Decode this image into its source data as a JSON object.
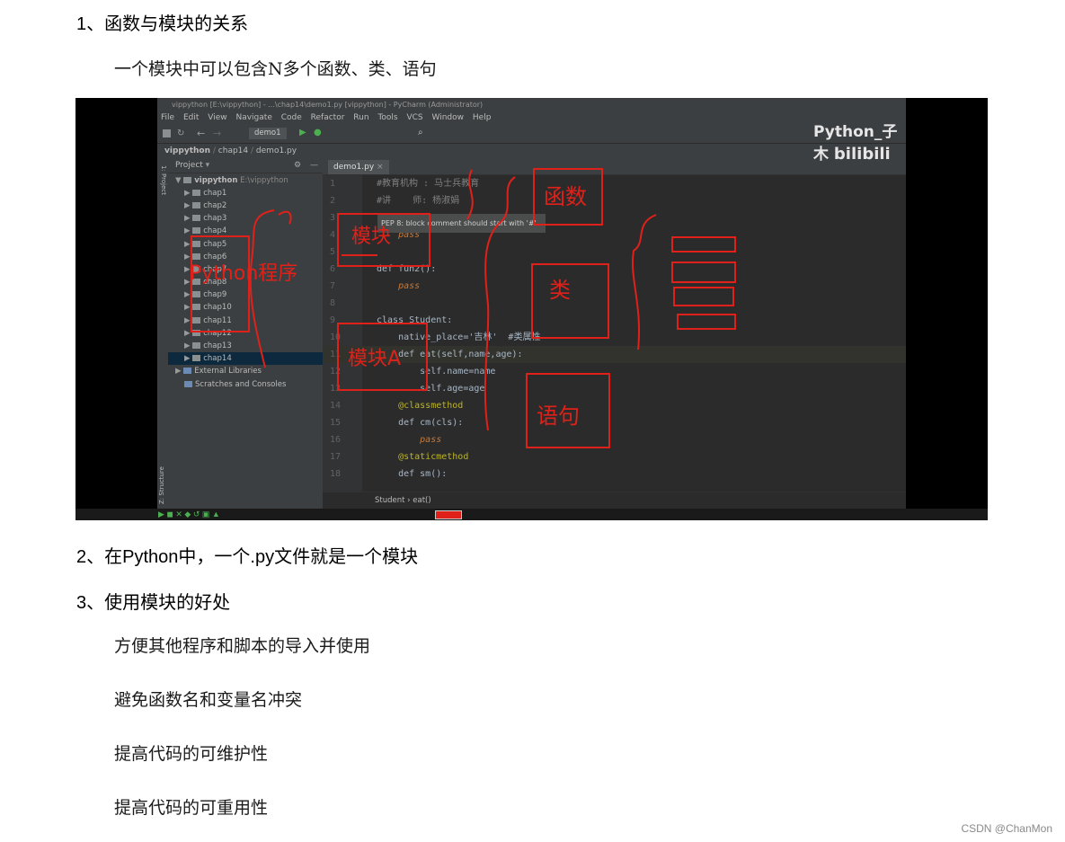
{
  "headings": {
    "h1": "1、函数与模块的关系",
    "h2": "2、在Python中，一个.py文件就是一个模块",
    "h3": "3、使用模块的好处"
  },
  "paragraphs": {
    "p1": "一个模块中可以包含N多个函数、类、语句",
    "b1": "方便其他程序和脚本的导入并使用",
    "b2": "避免函数名和变量名冲突",
    "b3": "提高代码的可维护性",
    "b4": "提高代码的可重用性"
  },
  "ide": {
    "title": "vippython [E:\\vippython] - ...\\chap14\\demo1.py [vippython] - PyCharm (Administrator)",
    "menu": [
      "File",
      "Edit",
      "View",
      "Navigate",
      "Code",
      "Refactor",
      "Run",
      "Tools",
      "VCS",
      "Window",
      "Help"
    ],
    "run_config": "demo1",
    "breadcrumb": [
      "vippython",
      "chap14",
      "demo1.py"
    ],
    "project_label": "Project",
    "project_root": "vippython",
    "project_root_path": "E:\\vippython",
    "folders": [
      "chap1",
      "chap2",
      "chap3",
      "chap4",
      "chap5",
      "chap6",
      "chap7",
      "chap8",
      "chap9",
      "chap10",
      "chap11",
      "chap12",
      "chap13",
      "chap14"
    ],
    "external_libraries": "External Libraries",
    "scratches": "Scratches and Consoles",
    "tab_name": "demo1.py",
    "lines": [
      {
        "n": "1",
        "text": "#教育机构 : 马士兵教育"
      },
      {
        "n": "2",
        "text": "#讲    师: 杨淑娟"
      },
      {
        "n": "3",
        "text": ""
      },
      {
        "n": "4",
        "text": "    pass"
      },
      {
        "n": "5",
        "text": ""
      },
      {
        "n": "6",
        "text": "def fun2():"
      },
      {
        "n": "7",
        "text": "    pass"
      },
      {
        "n": "8",
        "text": ""
      },
      {
        "n": "9",
        "text": "class Student:"
      },
      {
        "n": "10",
        "text": "    native_place='吉林'  #类属性"
      },
      {
        "n": "11",
        "text": "    def eat(self,name,age):"
      },
      {
        "n": "12",
        "text": "        self.name=name"
      },
      {
        "n": "13",
        "text": "        self.age=age"
      },
      {
        "n": "14",
        "text": "    @classmethod"
      },
      {
        "n": "15",
        "text": "    def cm(cls):"
      },
      {
        "n": "16",
        "text": "        pass"
      },
      {
        "n": "17",
        "text": "    @staticmethod"
      },
      {
        "n": "18",
        "text": "    def sm():"
      }
    ],
    "tooltip": "PEP 8: block comment should start with '#'",
    "footer_crumb": "Student  ›  eat()",
    "sidebar_structure": "Z: Structure",
    "sidebar_project": "1: Project"
  },
  "watermark": "Python_子木",
  "watermark_brand": "bilibili",
  "annotations": {
    "module": "模块",
    "python_program": "Python程序",
    "module_a": "模块A",
    "function": "函数",
    "class": "类",
    "statement": "语句"
  },
  "csdn": "CSDN @ChanMon",
  "colors": {
    "annotation": "#e0211a",
    "ide_bg": "#2b2b2b"
  }
}
